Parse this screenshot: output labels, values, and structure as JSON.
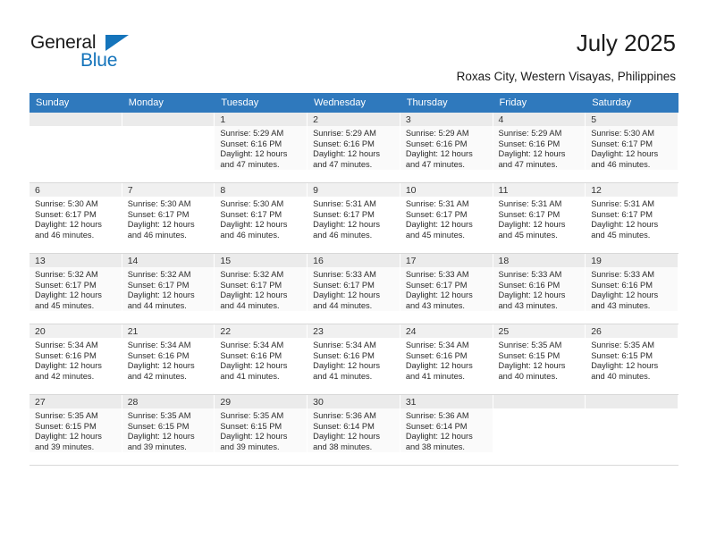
{
  "brand": {
    "name_top": "General",
    "name_bottom": "Blue",
    "accent_color": "#1574bb",
    "triangle_icon": "triangle-icon"
  },
  "header": {
    "month_title": "July 2025",
    "location": "Roxas City, Western Visayas, Philippines"
  },
  "calendar": {
    "header_bg": "#2f79bd",
    "weekdays": [
      "Sunday",
      "Monday",
      "Tuesday",
      "Wednesday",
      "Thursday",
      "Friday",
      "Saturday"
    ],
    "weeks": [
      [
        {
          "day": "",
          "sunrise": "",
          "sunset": "",
          "daylight1": "",
          "daylight2": ""
        },
        {
          "day": "",
          "sunrise": "",
          "sunset": "",
          "daylight1": "",
          "daylight2": ""
        },
        {
          "day": "1",
          "sunrise": "Sunrise: 5:29 AM",
          "sunset": "Sunset: 6:16 PM",
          "daylight1": "Daylight: 12 hours",
          "daylight2": "and 47 minutes."
        },
        {
          "day": "2",
          "sunrise": "Sunrise: 5:29 AM",
          "sunset": "Sunset: 6:16 PM",
          "daylight1": "Daylight: 12 hours",
          "daylight2": "and 47 minutes."
        },
        {
          "day": "3",
          "sunrise": "Sunrise: 5:29 AM",
          "sunset": "Sunset: 6:16 PM",
          "daylight1": "Daylight: 12 hours",
          "daylight2": "and 47 minutes."
        },
        {
          "day": "4",
          "sunrise": "Sunrise: 5:29 AM",
          "sunset": "Sunset: 6:16 PM",
          "daylight1": "Daylight: 12 hours",
          "daylight2": "and 47 minutes."
        },
        {
          "day": "5",
          "sunrise": "Sunrise: 5:30 AM",
          "sunset": "Sunset: 6:17 PM",
          "daylight1": "Daylight: 12 hours",
          "daylight2": "and 46 minutes."
        }
      ],
      [
        {
          "day": "6",
          "sunrise": "Sunrise: 5:30 AM",
          "sunset": "Sunset: 6:17 PM",
          "daylight1": "Daylight: 12 hours",
          "daylight2": "and 46 minutes."
        },
        {
          "day": "7",
          "sunrise": "Sunrise: 5:30 AM",
          "sunset": "Sunset: 6:17 PM",
          "daylight1": "Daylight: 12 hours",
          "daylight2": "and 46 minutes."
        },
        {
          "day": "8",
          "sunrise": "Sunrise: 5:30 AM",
          "sunset": "Sunset: 6:17 PM",
          "daylight1": "Daylight: 12 hours",
          "daylight2": "and 46 minutes."
        },
        {
          "day": "9",
          "sunrise": "Sunrise: 5:31 AM",
          "sunset": "Sunset: 6:17 PM",
          "daylight1": "Daylight: 12 hours",
          "daylight2": "and 46 minutes."
        },
        {
          "day": "10",
          "sunrise": "Sunrise: 5:31 AM",
          "sunset": "Sunset: 6:17 PM",
          "daylight1": "Daylight: 12 hours",
          "daylight2": "and 45 minutes."
        },
        {
          "day": "11",
          "sunrise": "Sunrise: 5:31 AM",
          "sunset": "Sunset: 6:17 PM",
          "daylight1": "Daylight: 12 hours",
          "daylight2": "and 45 minutes."
        },
        {
          "day": "12",
          "sunrise": "Sunrise: 5:31 AM",
          "sunset": "Sunset: 6:17 PM",
          "daylight1": "Daylight: 12 hours",
          "daylight2": "and 45 minutes."
        }
      ],
      [
        {
          "day": "13",
          "sunrise": "Sunrise: 5:32 AM",
          "sunset": "Sunset: 6:17 PM",
          "daylight1": "Daylight: 12 hours",
          "daylight2": "and 45 minutes."
        },
        {
          "day": "14",
          "sunrise": "Sunrise: 5:32 AM",
          "sunset": "Sunset: 6:17 PM",
          "daylight1": "Daylight: 12 hours",
          "daylight2": "and 44 minutes."
        },
        {
          "day": "15",
          "sunrise": "Sunrise: 5:32 AM",
          "sunset": "Sunset: 6:17 PM",
          "daylight1": "Daylight: 12 hours",
          "daylight2": "and 44 minutes."
        },
        {
          "day": "16",
          "sunrise": "Sunrise: 5:33 AM",
          "sunset": "Sunset: 6:17 PM",
          "daylight1": "Daylight: 12 hours",
          "daylight2": "and 44 minutes."
        },
        {
          "day": "17",
          "sunrise": "Sunrise: 5:33 AM",
          "sunset": "Sunset: 6:17 PM",
          "daylight1": "Daylight: 12 hours",
          "daylight2": "and 43 minutes."
        },
        {
          "day": "18",
          "sunrise": "Sunrise: 5:33 AM",
          "sunset": "Sunset: 6:16 PM",
          "daylight1": "Daylight: 12 hours",
          "daylight2": "and 43 minutes."
        },
        {
          "day": "19",
          "sunrise": "Sunrise: 5:33 AM",
          "sunset": "Sunset: 6:16 PM",
          "daylight1": "Daylight: 12 hours",
          "daylight2": "and 43 minutes."
        }
      ],
      [
        {
          "day": "20",
          "sunrise": "Sunrise: 5:34 AM",
          "sunset": "Sunset: 6:16 PM",
          "daylight1": "Daylight: 12 hours",
          "daylight2": "and 42 minutes."
        },
        {
          "day": "21",
          "sunrise": "Sunrise: 5:34 AM",
          "sunset": "Sunset: 6:16 PM",
          "daylight1": "Daylight: 12 hours",
          "daylight2": "and 42 minutes."
        },
        {
          "day": "22",
          "sunrise": "Sunrise: 5:34 AM",
          "sunset": "Sunset: 6:16 PM",
          "daylight1": "Daylight: 12 hours",
          "daylight2": "and 41 minutes."
        },
        {
          "day": "23",
          "sunrise": "Sunrise: 5:34 AM",
          "sunset": "Sunset: 6:16 PM",
          "daylight1": "Daylight: 12 hours",
          "daylight2": "and 41 minutes."
        },
        {
          "day": "24",
          "sunrise": "Sunrise: 5:34 AM",
          "sunset": "Sunset: 6:16 PM",
          "daylight1": "Daylight: 12 hours",
          "daylight2": "and 41 minutes."
        },
        {
          "day": "25",
          "sunrise": "Sunrise: 5:35 AM",
          "sunset": "Sunset: 6:15 PM",
          "daylight1": "Daylight: 12 hours",
          "daylight2": "and 40 minutes."
        },
        {
          "day": "26",
          "sunrise": "Sunrise: 5:35 AM",
          "sunset": "Sunset: 6:15 PM",
          "daylight1": "Daylight: 12 hours",
          "daylight2": "and 40 minutes."
        }
      ],
      [
        {
          "day": "27",
          "sunrise": "Sunrise: 5:35 AM",
          "sunset": "Sunset: 6:15 PM",
          "daylight1": "Daylight: 12 hours",
          "daylight2": "and 39 minutes."
        },
        {
          "day": "28",
          "sunrise": "Sunrise: 5:35 AM",
          "sunset": "Sunset: 6:15 PM",
          "daylight1": "Daylight: 12 hours",
          "daylight2": "and 39 minutes."
        },
        {
          "day": "29",
          "sunrise": "Sunrise: 5:35 AM",
          "sunset": "Sunset: 6:15 PM",
          "daylight1": "Daylight: 12 hours",
          "daylight2": "and 39 minutes."
        },
        {
          "day": "30",
          "sunrise": "Sunrise: 5:36 AM",
          "sunset": "Sunset: 6:14 PM",
          "daylight1": "Daylight: 12 hours",
          "daylight2": "and 38 minutes."
        },
        {
          "day": "31",
          "sunrise": "Sunrise: 5:36 AM",
          "sunset": "Sunset: 6:14 PM",
          "daylight1": "Daylight: 12 hours",
          "daylight2": "and 38 minutes."
        },
        {
          "day": "",
          "sunrise": "",
          "sunset": "",
          "daylight1": "",
          "daylight2": ""
        },
        {
          "day": "",
          "sunrise": "",
          "sunset": "",
          "daylight1": "",
          "daylight2": ""
        }
      ]
    ]
  }
}
